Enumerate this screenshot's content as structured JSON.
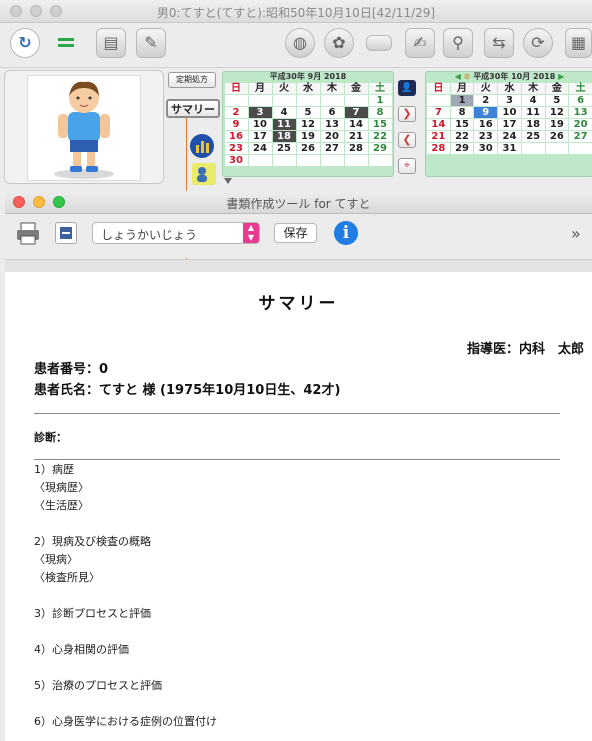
{
  "window": {
    "title": "男0:てすと(てすと):昭和50年10月10日[42/11/29]"
  },
  "toolbar_icons": [
    "app-logo-icon",
    "menu-lines-icon",
    "chart-record-icon",
    "clipboard-icon",
    "globe-icon",
    "palette-icon",
    "eraser-icon",
    "document-edit-icon",
    "people-search-icon",
    "transfer-icon",
    "refresh-icon",
    "document-icon"
  ],
  "side_buttons": {
    "teiki": "定期処方",
    "summary": "サマリー"
  },
  "calendar_sep": {
    "header": "平成30年 9月 2018",
    "weekdays": [
      "日",
      "月",
      "火",
      "水",
      "木",
      "金",
      "土"
    ],
    "weeks": [
      [
        "",
        "",
        "",
        "",
        "",
        "",
        "1"
      ],
      [
        "2",
        "3",
        "4",
        "5",
        "6",
        "7",
        "8"
      ],
      [
        "9",
        "10",
        "11",
        "12",
        "13",
        "14",
        "15"
      ],
      [
        "16",
        "17",
        "18",
        "19",
        "20",
        "21",
        "22"
      ],
      [
        "23",
        "24",
        "25",
        "26",
        "27",
        "28",
        "29"
      ],
      [
        "30",
        "",
        "",
        "",
        "",
        "",
        ""
      ]
    ]
  },
  "calendar_oct": {
    "header": "平成30年 10月 2018",
    "weekdays": [
      "日",
      "月",
      "火",
      "水",
      "木",
      "金",
      "土"
    ],
    "weeks": [
      [
        "",
        "1",
        "2",
        "3",
        "4",
        "5",
        "6"
      ],
      [
        "7",
        "8",
        "9",
        "10",
        "11",
        "12",
        "13"
      ],
      [
        "14",
        "15",
        "16",
        "17",
        "18",
        "19",
        "20"
      ],
      [
        "21",
        "22",
        "23",
        "24",
        "25",
        "26",
        "27"
      ],
      [
        "28",
        "29",
        "30",
        "31",
        "",
        "",
        ""
      ]
    ]
  },
  "inner_window": {
    "title": "書類作成ツール for てすと",
    "doc_select": "しょうかいじょう",
    "save_label": "保存",
    "info": "i",
    "more": "»"
  },
  "document": {
    "heading": "サマリー",
    "doctor": "指導医：内科　太郎",
    "patient_no": "患者番号：0",
    "patient_name": "患者氏名：てすと 様 (1975年10月10日生、42才)",
    "diagnosis": "診断：",
    "lines": [
      "1）病歴",
      "〈現病歴〉",
      "〈生活歴〉",
      "",
      "2）現病及び検査の概略",
      "〈現病〉",
      "〈検査所見〉",
      "",
      "3）診断プロセスと評価",
      "",
      "4）心身相関の評価",
      "",
      "5）治療のプロセスと評価",
      "",
      "6）心身医学における症例の位置付け"
    ]
  }
}
